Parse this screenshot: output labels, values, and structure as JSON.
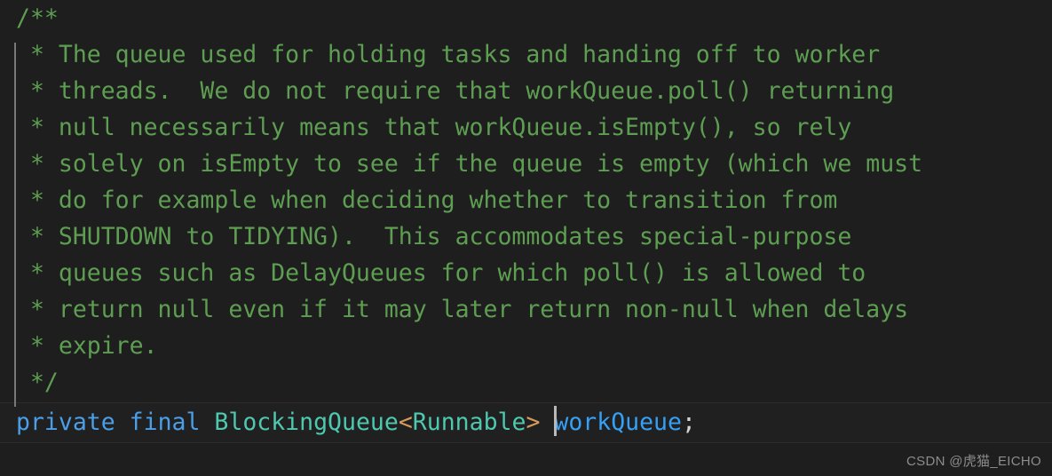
{
  "editor": {
    "background_color": "#1e1e1e",
    "current_line_background": "#202020",
    "comment_color": "#5e9e52",
    "keyword_color": "#4a9fe8",
    "type_color": "#4ec9b0",
    "generic_bracket_color": "#d79a5a",
    "variable_color": "#35a0f5",
    "guide_color": "#787878",
    "caret_color": "#b8b8b8"
  },
  "comment_block": {
    "open": "/**",
    "lines": [
      " * The queue used for holding tasks and handing off to worker",
      " * threads.  We do not require that workQueue.poll() returning",
      " * null necessarily means that workQueue.isEmpty(), so rely",
      " * solely on isEmpty to see if the queue is empty (which we must",
      " * do for example when deciding whether to transition from",
      " * SHUTDOWN to TIDYING).  This accommodates special-purpose",
      " * queues such as DelayQueues for which poll() is allowed to",
      " * return null even if it may later return non-null when delays",
      " * expire."
    ],
    "close": " */"
  },
  "declaration": {
    "modifier_private": "private",
    "modifier_final": "final",
    "space1": " ",
    "space2": " ",
    "type": "BlockingQueue",
    "angle_open": "<",
    "generic_type": "Runnable",
    "angle_close": ">",
    "space3": " ",
    "variable": "workQueue",
    "semicolon": ";"
  },
  "watermark": {
    "text": "CSDN @虎猫_EICHO"
  }
}
